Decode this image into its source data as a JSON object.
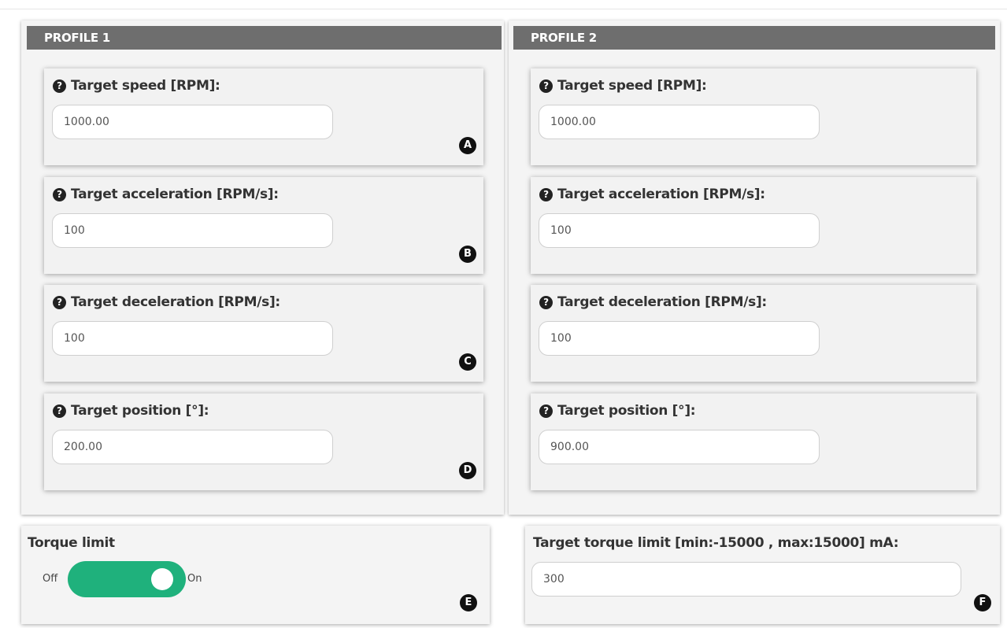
{
  "profiles": [
    {
      "title": "PROFILE 1",
      "fields": [
        {
          "label": "Target speed [RPM]:",
          "value": "1000.00",
          "marker": "A"
        },
        {
          "label": "Target acceleration [RPM/s]:",
          "value": "100",
          "marker": "B"
        },
        {
          "label": "Target deceleration [RPM/s]:",
          "value": "100",
          "marker": "C"
        },
        {
          "label": "Target position [°]:",
          "value": "200.00",
          "marker": "D"
        }
      ]
    },
    {
      "title": "PROFILE 2",
      "fields": [
        {
          "label": "Target speed [RPM]:",
          "value": "1000.00"
        },
        {
          "label": "Target acceleration [RPM/s]:",
          "value": "100"
        },
        {
          "label": "Target deceleration [RPM/s]:",
          "value": "100"
        },
        {
          "label": "Target position [°]:",
          "value": "900.00"
        }
      ]
    }
  ],
  "torque": {
    "label": "Torque limit",
    "off_label": "Off",
    "on_label": "On",
    "enabled": true,
    "marker": "E",
    "accent_color": "#1fb17c"
  },
  "torque_target": {
    "label": "Target torque limit [min:-15000 , max:15000] mA:",
    "value": "300",
    "marker": "F"
  },
  "icons": {
    "help": "question-circle-icon",
    "help_glyph": "?"
  }
}
